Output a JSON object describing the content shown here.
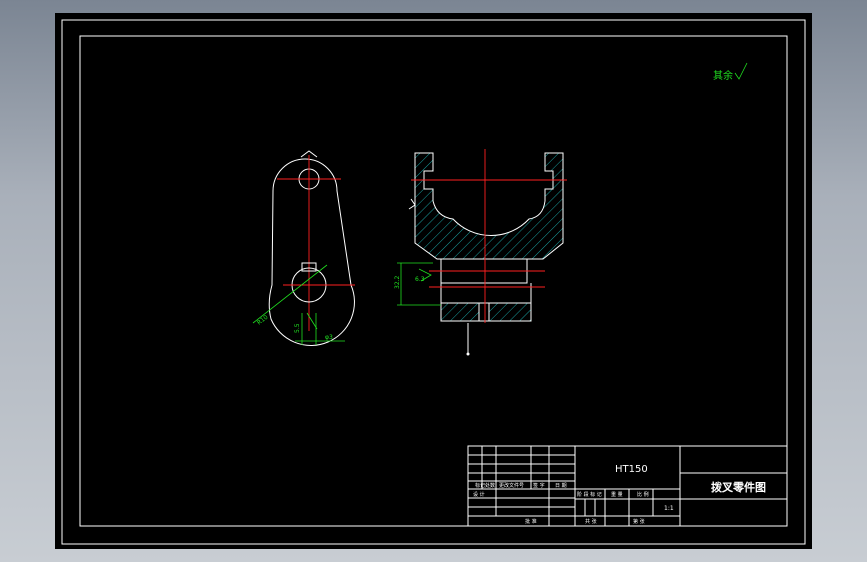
{
  "drawing": {
    "roughness_note": "其余",
    "material": "HT150",
    "part_name": "拨叉零件图",
    "scale": "1:1"
  },
  "title_block": {
    "row_labels": [
      "标记",
      "处数",
      "更改文件号",
      "签 字",
      "日 期"
    ],
    "design_label": "设 计",
    "standard_label": "标准化",
    "stage_mark_label": "阶 段 标 记",
    "weight_label": "重 量",
    "ratio_label": "比 例",
    "approval_label": "批 准",
    "sheet_count_label": "共   张",
    "sheet_label": "第   张"
  },
  "dimensions": {
    "radius_label": "R10",
    "dia_label": "φ3",
    "width_label": "5.5",
    "left_height": "32.2",
    "ratio_small": "6.3",
    "bore_label": "φ12"
  },
  "colors": {
    "paper": "#000000",
    "outline": "#ffffff",
    "centerline": "#ff2020",
    "dimension": "#20e020",
    "hatch": "#20c8c8"
  }
}
